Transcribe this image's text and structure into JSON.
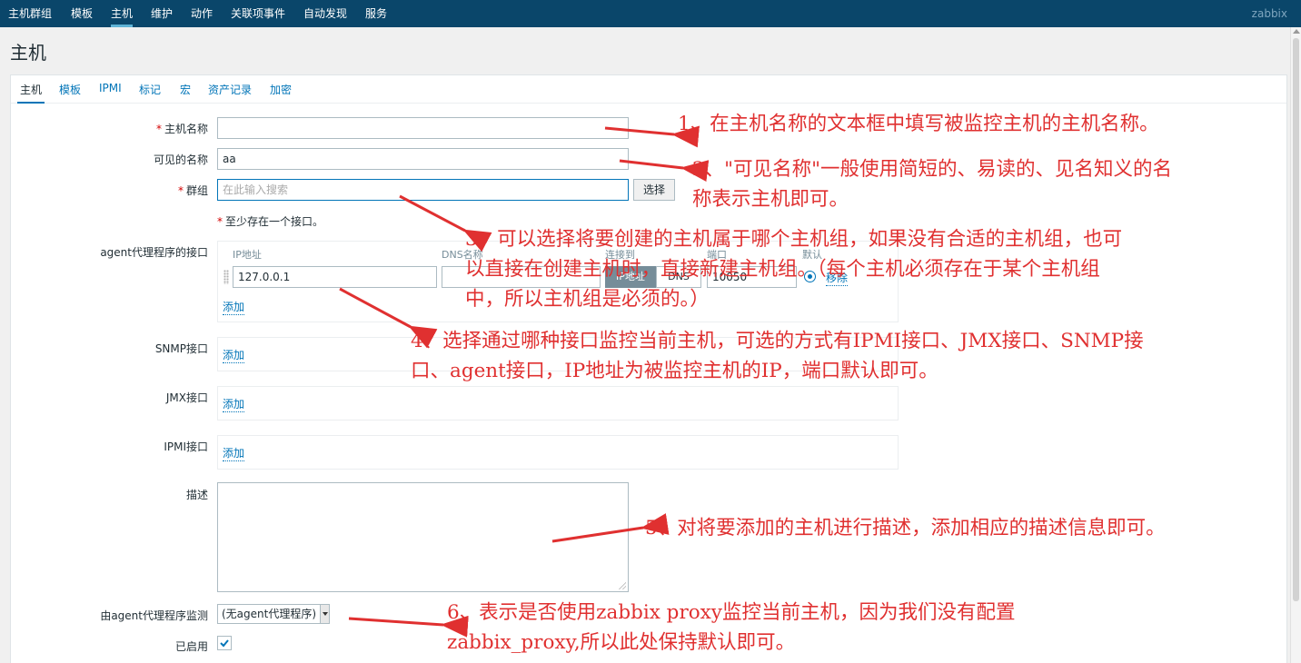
{
  "topnav": {
    "items": [
      "主机群组",
      "模板",
      "主机",
      "维护",
      "动作",
      "关联项事件",
      "自动发现",
      "服务"
    ],
    "active_index": 2,
    "brand": "zabbix"
  },
  "page": {
    "title": "主机"
  },
  "tabs": [
    "主机",
    "模板",
    "IPMI",
    "标记",
    "宏",
    "资产记录",
    "加密"
  ],
  "form": {
    "host_name": {
      "label": "主机名称",
      "value": ""
    },
    "visible_name": {
      "label": "可见的名称",
      "value": "aa"
    },
    "groups": {
      "label": "群组",
      "placeholder": "在此输入搜索",
      "select_button": "选择"
    },
    "interface_required_note": "至少存在一个接口。",
    "agent_interfaces": {
      "label": "agent代理程序的接口",
      "headers": {
        "ip": "IP地址",
        "dns": "DNS名称",
        "connect": "连接到",
        "port": "端口",
        "default": "默认"
      },
      "row": {
        "ip": "127.0.0.1",
        "dns": "",
        "connect_ip": "IP地址",
        "connect_dns": "DNS",
        "port": "10050",
        "remove": "移除"
      },
      "add": "添加"
    },
    "snmp": {
      "label": "SNMP接口",
      "add": "添加"
    },
    "jmx": {
      "label": "JMX接口",
      "add": "添加"
    },
    "ipmi": {
      "label": "IPMI接口",
      "add": "添加"
    },
    "description": {
      "label": "描述",
      "value": ""
    },
    "proxy": {
      "label": "由agent代理程序监测",
      "selected": "(无agent代理程序)"
    },
    "enabled": {
      "label": "已启用",
      "checked": true
    }
  },
  "annotations": {
    "a1": "1、在主机名称的文本框中填写被监控主机的主机名称。",
    "a2_l1": "2、\"可见名称\"一般使用简短的、易读的、见名知义的名",
    "a2_l2": "称表示主机即可。",
    "a3_l1": "3、可以选择将要创建的主机属于哪个主机组，如果没有合适的主机组，也可",
    "a3_l2": "以直接在创建主机时，直接新建主机组。（每个主机必须存在于某个主机组",
    "a3_l3": "中，所以主机组是必须的。）",
    "a4_l1": "4、选择通过哪种接口监控当前主机，可选的方式有IPMI接口、JMX接口、SNMP接",
    "a4_l2": "口、agent接口，IP地址为被监控主机的IP，端口默认即可。",
    "a5": "5、对将要添加的主机进行描述，添加相应的描述信息即可。",
    "a6_l1": "6、表示是否使用zabbix proxy监控当前主机，因为我们没有配置",
    "a6_l2": "zabbix_proxy,所以此处保持默认即可。",
    "color": "#e03030"
  },
  "colors": {
    "header_bg": "#0a466a",
    "link": "#0275b8",
    "required": "#d40000"
  }
}
